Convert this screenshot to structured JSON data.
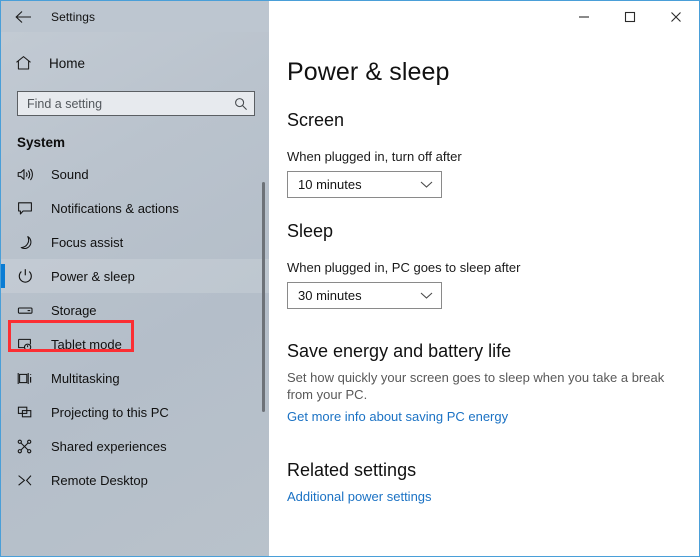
{
  "window": {
    "title": "Settings",
    "back_icon": "back-arrow-icon",
    "controls": [
      {
        "name": "minimize-button",
        "icon": "minimize-icon"
      },
      {
        "name": "maximize-button",
        "icon": "maximize-icon"
      },
      {
        "name": "close-button",
        "icon": "close-icon"
      }
    ]
  },
  "sidebar": {
    "home_label": "Home",
    "home_icon": "home-icon",
    "search": {
      "placeholder": "Find a setting",
      "value": "",
      "icon": "search-icon"
    },
    "group_title": "System",
    "selected_index": 3,
    "accent_color": "#0a7cd4",
    "highlight_color": "#fb2e33",
    "items": [
      {
        "label": "Sound",
        "icon": "speaker-icon"
      },
      {
        "label": "Notifications & actions",
        "icon": "notification-icon"
      },
      {
        "label": "Focus assist",
        "icon": "moon-icon"
      },
      {
        "label": "Power & sleep",
        "icon": "power-icon"
      },
      {
        "label": "Storage",
        "icon": "drive-icon"
      },
      {
        "label": "Tablet mode",
        "icon": "tablet-icon"
      },
      {
        "label": "Multitasking",
        "icon": "multitasking-icon"
      },
      {
        "label": "Projecting to this PC",
        "icon": "projecting-icon"
      },
      {
        "label": "Shared experiences",
        "icon": "shared-experiences-icon"
      },
      {
        "label": "Remote Desktop",
        "icon": "remote-desktop-icon"
      }
    ]
  },
  "main": {
    "page_title": "Power & sleep",
    "screen": {
      "heading": "Screen",
      "field_label": "When plugged in, turn off after",
      "value": "10 minutes",
      "chevron_icon": "chevron-down-icon"
    },
    "sleep": {
      "heading": "Sleep",
      "field_label": "When plugged in, PC goes to sleep after",
      "value": "30 minutes",
      "chevron_icon": "chevron-down-icon"
    },
    "energy": {
      "heading": "Save energy and battery life",
      "description": "Set how quickly your screen goes to sleep when you take a break from your PC.",
      "link": "Get more info about saving PC energy",
      "link_color": "#1b72c4"
    },
    "related": {
      "heading": "Related settings",
      "link": "Additional power settings"
    }
  }
}
